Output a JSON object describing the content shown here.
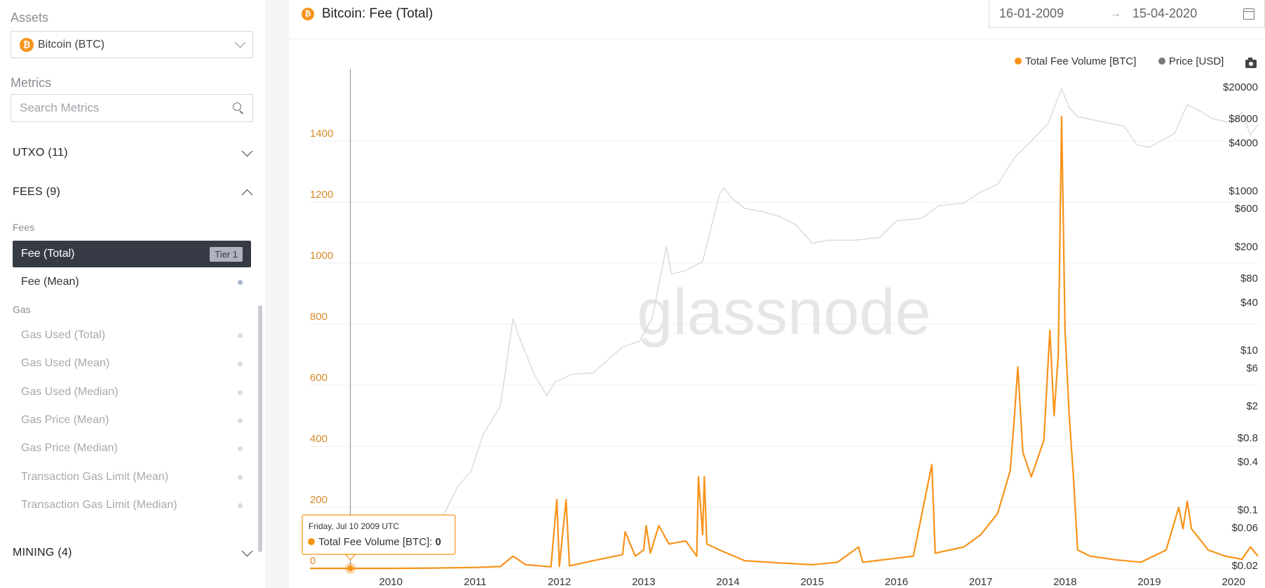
{
  "sidebar": {
    "assets_label": "Assets",
    "asset_selected": "Bitcoin (BTC)",
    "metrics_label": "Metrics",
    "search_placeholder": "Search Metrics",
    "groups": {
      "utxo": "UTXO (11)",
      "fees": "FEES (9)",
      "mining": "MINING (4)"
    },
    "fees_sub": "Fees",
    "gas_sub": "Gas",
    "fee_items": [
      {
        "label": "Fee (Total)",
        "badge": "Tier 1"
      },
      {
        "label": "Fee (Mean)"
      }
    ],
    "gas_items": [
      {
        "label": "Gas Used (Total)"
      },
      {
        "label": "Gas Used (Mean)"
      },
      {
        "label": "Gas Used (Median)"
      },
      {
        "label": "Gas Price (Mean)"
      },
      {
        "label": "Gas Price (Median)"
      },
      {
        "label": "Transaction Gas Limit (Mean)"
      },
      {
        "label": "Transaction Gas Limit (Median)"
      }
    ]
  },
  "header": {
    "title": "Bitcoin: Fee (Total)",
    "date_from": "16-01-2009",
    "date_to": "15-04-2020",
    "date_arrow": "→"
  },
  "colors": {
    "fee": "#f7931a",
    "price": "#dadada",
    "accent": "#f7931a",
    "active_item": "#353a45"
  },
  "chart_data": {
    "type": "line",
    "watermark": "glassnode",
    "legend": {
      "placement": "top-right",
      "entries": [
        "Total Fee Volume [BTC]",
        "Price [USD]"
      ]
    },
    "x_ticks": [
      "2010",
      "2011",
      "2012",
      "2013",
      "2014",
      "2015",
      "2016",
      "2017",
      "2018",
      "2019",
      "2020"
    ],
    "x_range": [
      2009.04,
      2020.29
    ],
    "y_left": {
      "ticks": [
        0,
        200,
        400,
        600,
        800,
        1000,
        1200,
        1400
      ],
      "ylim": [
        0,
        1600
      ]
    },
    "y_right": {
      "scale": "log",
      "ticks": [
        "$20000",
        "$8000",
        "$4000",
        "$1000",
        "$600",
        "$200",
        "$80",
        "$40",
        "$10",
        "$6",
        "$2",
        "$0.8",
        "$0.4",
        "$0.1",
        "$0.06",
        "$0.02"
      ],
      "tick_values": [
        20000,
        8000,
        4000,
        1000,
        600,
        200,
        80,
        40,
        10,
        6,
        2,
        0.8,
        0.4,
        0.1,
        0.06,
        0.02
      ]
    },
    "series": [
      {
        "name": "Total Fee Volume [BTC]",
        "points": [
          [
            2009.04,
            0
          ],
          [
            2010.0,
            0
          ],
          [
            2010.5,
            1
          ],
          [
            2011.0,
            3
          ],
          [
            2011.3,
            6
          ],
          [
            2011.45,
            40
          ],
          [
            2011.6,
            12
          ],
          [
            2011.9,
            5
          ],
          [
            2011.97,
            225
          ],
          [
            2012.0,
            6
          ],
          [
            2012.08,
            225
          ],
          [
            2012.12,
            8
          ],
          [
            2012.4,
            25
          ],
          [
            2012.75,
            45
          ],
          [
            2012.78,
            120
          ],
          [
            2012.9,
            40
          ],
          [
            2013.0,
            60
          ],
          [
            2013.03,
            140
          ],
          [
            2013.08,
            50
          ],
          [
            2013.18,
            140
          ],
          [
            2013.3,
            80
          ],
          [
            2013.5,
            90
          ],
          [
            2013.63,
            40
          ],
          [
            2013.65,
            300
          ],
          [
            2013.7,
            110
          ],
          [
            2013.72,
            300
          ],
          [
            2013.75,
            80
          ],
          [
            2013.9,
            60
          ],
          [
            2014.2,
            25
          ],
          [
            2014.6,
            18
          ],
          [
            2015.0,
            12
          ],
          [
            2015.3,
            20
          ],
          [
            2015.55,
            70
          ],
          [
            2015.6,
            20
          ],
          [
            2015.9,
            30
          ],
          [
            2016.2,
            40
          ],
          [
            2016.42,
            340
          ],
          [
            2016.46,
            50
          ],
          [
            2016.8,
            70
          ],
          [
            2017.0,
            110
          ],
          [
            2017.2,
            180
          ],
          [
            2017.35,
            320
          ],
          [
            2017.4,
            500
          ],
          [
            2017.44,
            660
          ],
          [
            2017.5,
            380
          ],
          [
            2017.6,
            300
          ],
          [
            2017.75,
            420
          ],
          [
            2017.82,
            780
          ],
          [
            2017.87,
            500
          ],
          [
            2017.92,
            700
          ],
          [
            2017.96,
            1480
          ],
          [
            2018.0,
            780
          ],
          [
            2018.05,
            500
          ],
          [
            2018.1,
            300
          ],
          [
            2018.15,
            60
          ],
          [
            2018.3,
            40
          ],
          [
            2018.6,
            28
          ],
          [
            2018.9,
            20
          ],
          [
            2019.2,
            60
          ],
          [
            2019.35,
            200
          ],
          [
            2019.4,
            130
          ],
          [
            2019.45,
            220
          ],
          [
            2019.5,
            130
          ],
          [
            2019.7,
            60
          ],
          [
            2019.9,
            40
          ],
          [
            2020.1,
            30
          ],
          [
            2020.2,
            70
          ],
          [
            2020.29,
            40
          ]
        ]
      },
      {
        "name": "Price [USD]",
        "points": [
          [
            2010.55,
            0.06
          ],
          [
            2010.8,
            0.2
          ],
          [
            2010.95,
            0.3
          ],
          [
            2011.1,
            0.9
          ],
          [
            2011.3,
            2
          ],
          [
            2011.45,
            25
          ],
          [
            2011.52,
            15
          ],
          [
            2011.7,
            5
          ],
          [
            2011.85,
            2.7
          ],
          [
            2011.95,
            4
          ],
          [
            2012.15,
            5
          ],
          [
            2012.4,
            5.2
          ],
          [
            2012.6,
            8
          ],
          [
            2012.75,
            11
          ],
          [
            2012.95,
            13
          ],
          [
            2013.1,
            25
          ],
          [
            2013.27,
            200
          ],
          [
            2013.33,
            90
          ],
          [
            2013.5,
            100
          ],
          [
            2013.7,
            130
          ],
          [
            2013.9,
            900
          ],
          [
            2013.95,
            1100
          ],
          [
            2014.05,
            800
          ],
          [
            2014.2,
            600
          ],
          [
            2014.4,
            550
          ],
          [
            2014.6,
            480
          ],
          [
            2014.8,
            380
          ],
          [
            2015.0,
            220
          ],
          [
            2015.2,
            240
          ],
          [
            2015.5,
            240
          ],
          [
            2015.8,
            260
          ],
          [
            2016.0,
            420
          ],
          [
            2016.3,
            450
          ],
          [
            2016.5,
            650
          ],
          [
            2016.8,
            700
          ],
          [
            2017.0,
            970
          ],
          [
            2017.2,
            1200
          ],
          [
            2017.4,
            2600
          ],
          [
            2017.6,
            4200
          ],
          [
            2017.8,
            7000
          ],
          [
            2017.96,
            19000
          ],
          [
            2018.05,
            11000
          ],
          [
            2018.15,
            8500
          ],
          [
            2018.4,
            7500
          ],
          [
            2018.7,
            6500
          ],
          [
            2018.85,
            3800
          ],
          [
            2019.0,
            3500
          ],
          [
            2019.3,
            5200
          ],
          [
            2019.45,
            12000
          ],
          [
            2019.6,
            10000
          ],
          [
            2019.75,
            8000
          ],
          [
            2019.95,
            7200
          ],
          [
            2020.1,
            9500
          ],
          [
            2020.2,
            5000
          ],
          [
            2020.29,
            6800
          ]
        ]
      }
    ],
    "tooltip": {
      "date": "Friday, Jul 10 2009 UTC",
      "series": "Total Fee Volume [BTC]",
      "value": "0",
      "x": 2009.52
    }
  }
}
